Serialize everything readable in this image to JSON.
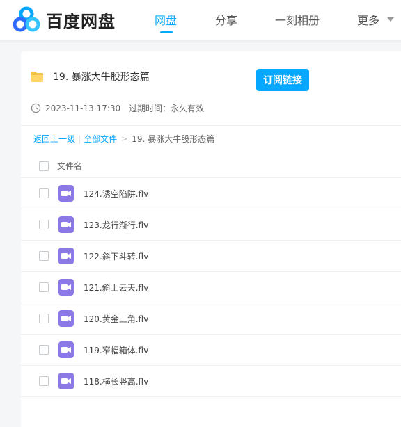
{
  "header": {
    "logo_text": "百度网盘",
    "nav": [
      {
        "label": "网盘"
      },
      {
        "label": "分享"
      },
      {
        "label": "一刻相册"
      },
      {
        "label": "更多"
      }
    ],
    "accent_color": "#06a7ff"
  },
  "share": {
    "folder_title": "19. 暴涨大牛股形态篇",
    "subscribe_label": "订阅链接",
    "created_at": "2023-11-13 17:30",
    "expiry_label": "过期时间：永久有效"
  },
  "breadcrumb": {
    "back": "返回上一级",
    "separator": "|",
    "all_files": "全部文件",
    "arrow": ">",
    "current": "19. 暴涨大牛股形态篇"
  },
  "table": {
    "column_header": "文件名",
    "files": [
      {
        "name": "124.诱空陷阱.flv",
        "icon": "video-file-icon"
      },
      {
        "name": "123.龙行渐行.flv",
        "icon": "video-file-icon"
      },
      {
        "name": "122.斜下斗转.flv",
        "icon": "video-file-icon"
      },
      {
        "name": "121.斜上云天.flv",
        "icon": "video-file-icon"
      },
      {
        "name": "120.黄金三角.flv",
        "icon": "video-file-icon"
      },
      {
        "name": "119.窄幅箱体.flv",
        "icon": "video-file-icon"
      },
      {
        "name": "118.横长竖高.flv",
        "icon": "video-file-icon"
      }
    ]
  }
}
